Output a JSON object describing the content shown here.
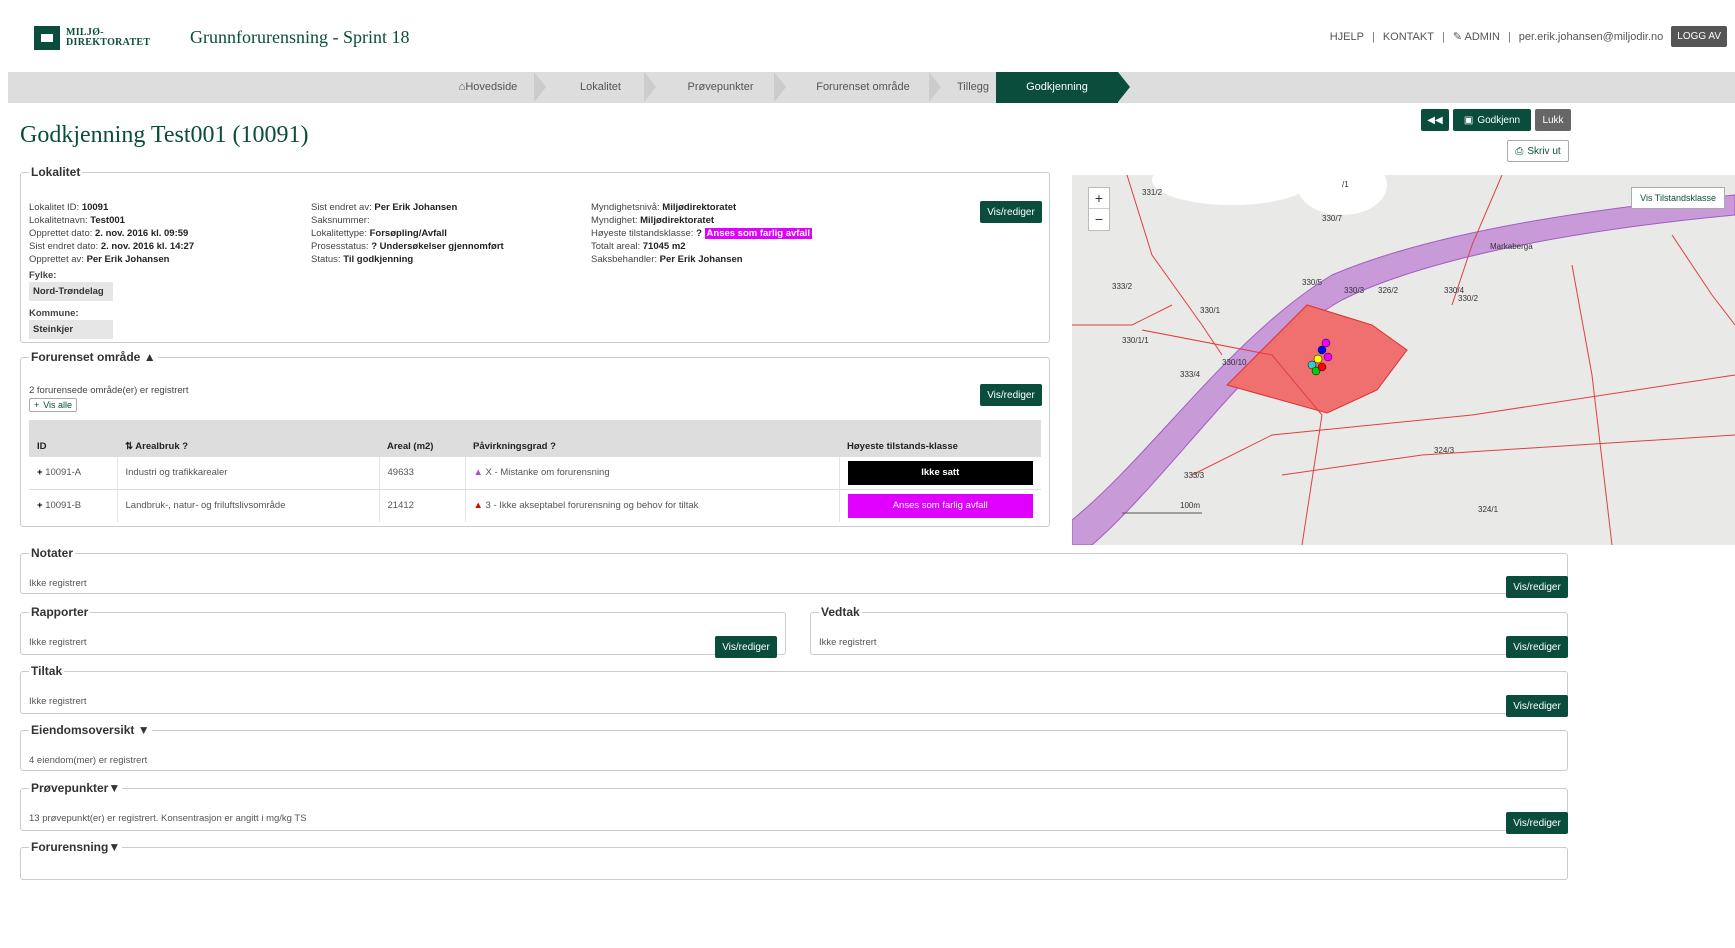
{
  "header": {
    "logo_line1": "MILJØ-",
    "logo_line2": "DIREKTORATET",
    "app_title": "Grunnforurensning - Sprint 18",
    "help": "HJELP",
    "contact": "KONTAKT",
    "admin": "ADMIN",
    "user_email": "per.erik.johansen@miljodir.no",
    "logout": "LOGG AV",
    "sep": "|"
  },
  "nav": {
    "items": [
      "Hovedside",
      "Lokalitet",
      "Prøvepunkter",
      "Forurenset område",
      "Tillegg",
      "Godkjenning"
    ],
    "active": "Godkjenning"
  },
  "page": {
    "title": "Godkjenning Test001 (10091)",
    "approve_label": "Godkjenn",
    "close_label": "Lukk",
    "print_label": "Skriv ut"
  },
  "lokalitet": {
    "legend": "Lokalitet",
    "edit": "Vis/rediger",
    "col1": [
      {
        "label": "Lokalitet ID:",
        "value": "10091"
      },
      {
        "label": "Lokalitetnavn:",
        "value": "Test001"
      },
      {
        "label": "Opprettet dato:",
        "value": "2. nov. 2016 kl. 09:59"
      },
      {
        "label": "Sist endret dato:",
        "value": "2. nov. 2016 kl. 14:27"
      },
      {
        "label": "Opprettet av:",
        "value": "Per Erik Johansen"
      }
    ],
    "col2": [
      {
        "label": "Sist endret av:",
        "value": "Per Erik Johansen"
      },
      {
        "label": "Saksnummer:",
        "value": ""
      },
      {
        "label": "Lokalitettype:",
        "value": "Forsøpling/Avfall"
      },
      {
        "label": "Prosesstatus:",
        "value": "Undersøkelser gjennomført"
      },
      {
        "label": "Status:",
        "value": "Til godkjenning"
      }
    ],
    "col3": [
      {
        "label": "Myndighetsnivå:",
        "value": "Miljødirektoratet"
      },
      {
        "label": "Myndighet:",
        "value": "Miljødirektoratet"
      },
      {
        "label": "Høyeste tilstandsklasse:",
        "value": "Anses som farlig avfall"
      },
      {
        "label": "Totalt areal:",
        "value": "71045 m2"
      },
      {
        "label": "Saksbehandler:",
        "value": "Per Erik Johansen"
      }
    ],
    "fylke_label": "Fylke:",
    "fylke": "Nord-Trøndelag",
    "kommune_label": "Kommune:",
    "kommune": "Steinkjer"
  },
  "forurenset": {
    "legend": "Forurenset område",
    "count_text": "2 forurensede område(er) er registrert",
    "show_all": "Vis alle",
    "edit": "Vis/rediger",
    "headers": [
      "ID",
      "Arealbruk",
      "Areal (m2)",
      "Påvirkningsgrad",
      "Høyeste tilstands-klasse"
    ],
    "rows": [
      {
        "id": "10091-A",
        "arealbruk": "Industri og trafikkarealer",
        "areal": "49633",
        "grad": "X - Mistanke om forurensning",
        "klasse": "Ikke satt",
        "grad_color": "#b04cc8"
      },
      {
        "id": "10091-B",
        "arealbruk": "Landbruk-, natur- og friluftslivsområde",
        "areal": "21412",
        "grad": "3 - Ikke akseptabel forurensning og behov for tiltak",
        "klasse": "Anses som farlig avfall",
        "grad_color": "#e00000"
      }
    ]
  },
  "map": {
    "legend_button": "Vis Tilstandsklasse",
    "zoom_in": "+",
    "zoom_out": "−",
    "labels": [
      "331/2",
      "/1",
      "330/7",
      "330/5",
      "330/3",
      "326/2",
      "330/4",
      "330/2",
      "333/2",
      "330/1",
      "330/1/1",
      "330/10",
      "333/4",
      "324/3",
      "333/3",
      "324/1",
      "Markaberga"
    ],
    "scale": "100m"
  },
  "notater": {
    "legend": "Notater",
    "text": "Ikke registrert",
    "edit": "Vis/rediger"
  },
  "rapporter": {
    "legend": "Rapporter",
    "text": "Ikke registrert",
    "edit": "Vis/rediger"
  },
  "vedtak": {
    "legend": "Vedtak",
    "text": "Ikke registrert",
    "edit": "Vis/rediger"
  },
  "tiltak": {
    "legend": "Tiltak",
    "text": "Ikke registrert",
    "edit": "Vis/rediger"
  },
  "eiendom": {
    "legend": "Eiendomsoversikt",
    "text": "4 eiendom(mer) er registrert"
  },
  "provepunkter": {
    "legend": "Prøvepunkter",
    "text": "13 prøvepunkt(er) er registrert. Konsentrasjon er angitt i mg/kg TS",
    "edit": "Vis/rediger"
  },
  "forurensning": {
    "legend": "Forurensning"
  }
}
